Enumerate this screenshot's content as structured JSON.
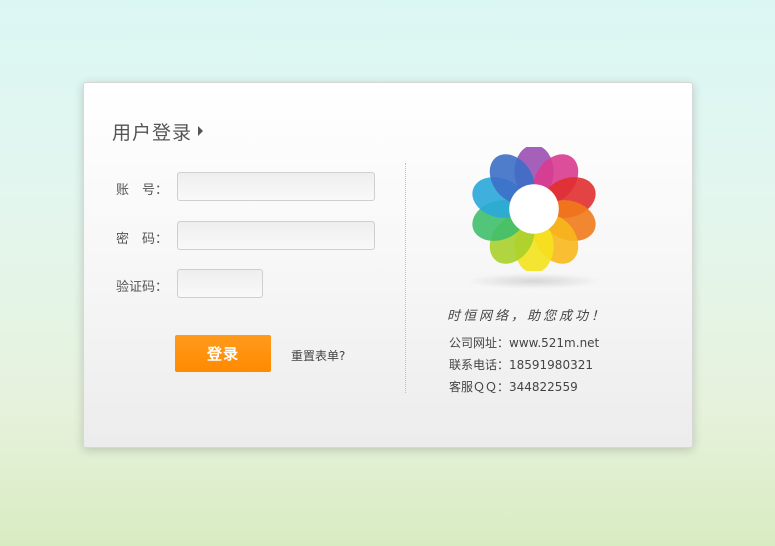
{
  "login": {
    "title": "用户登录",
    "account_label": "账　号：",
    "password_label": "密　码：",
    "captcha_label": "验证码：",
    "account_value": "",
    "password_value": "",
    "captcha_value": "",
    "login_button": "登录",
    "reset_link": "重置表单?"
  },
  "company": {
    "slogan": "时恒网络，助您成功！",
    "website": "公司网址：www.521m.net",
    "phone": "联系电话：18591980321",
    "qq": "客服ＱＱ：344822559"
  },
  "colors": {
    "accent": "#ff8a00",
    "background_top": "#dbf7f4",
    "background_bottom": "#d8ecc2"
  },
  "icons": {
    "logo": "rainbow-swirl-logo",
    "title_arrow": "triangle-right-icon"
  }
}
